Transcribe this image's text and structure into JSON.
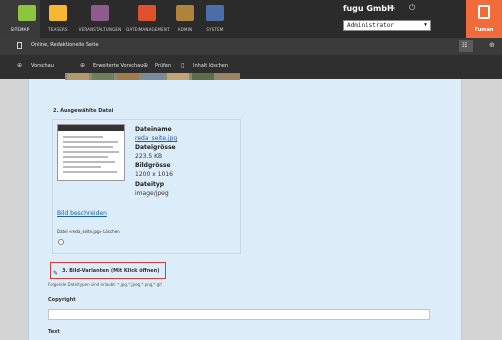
{
  "topnav": {
    "items": [
      {
        "label": "SITEMAP",
        "icon": "sitemap-icon",
        "color": "#8cc63f"
      },
      {
        "label": "TEASERS",
        "icon": "teaser-icon",
        "color": "#f7b731"
      },
      {
        "label": "VERANSTALTUNGEN",
        "icon": "events-icon",
        "color": "#8e5b8e"
      },
      {
        "label": "DATEIMANAGEMENT",
        "icon": "file-management-icon",
        "color": "#e0522e"
      },
      {
        "label": "ADMIN",
        "icon": "admin-folder-icon",
        "color": "#b0833b"
      },
      {
        "label": "SYSTEM",
        "icon": "system-gear-icon",
        "color": "#4a6ea8"
      }
    ],
    "company": "fugu GmbH",
    "role_value": "Administrator",
    "logo_text": "Fuman"
  },
  "pagebar": {
    "title": "Online, Redaktionelle Seite"
  },
  "toolbar": {
    "preview": "Vorschau",
    "extended_preview": "Erweiterte Vorschau",
    "check": "Prüfen",
    "delete_content": "Inhalt löschen"
  },
  "section2": {
    "title": "2. Ausgewählte Datei",
    "filename_label": "Dateiname",
    "filename_value": "reda_seite.jpg",
    "filesize_label": "Dateigrösse",
    "filesize_value": "223.5 KB",
    "imagesize_label": "Bildgrösse",
    "imagesize_value": "1200 x 1016",
    "filetype_label": "Dateityp",
    "filetype_value": "image/jpeg",
    "describe_link": "Bild beschreiden",
    "delete_text": "Datei «reda_seite.jpg» Löschen"
  },
  "section3": {
    "title": "3. Bild-Varianten (Mit Klick öffnen)",
    "filetypes_note": "Folgende Dateitypen sind erlaubt: *.jpg,*.jpeg,*.png,*.gif"
  },
  "fields": {
    "copyright_label": "Copyright",
    "text_label": "Text"
  },
  "colors": {
    "panel_bg": "#dcedf9",
    "highlight_border": "#d93a3a",
    "link": "#1b5fa8",
    "brand": "#f26b3a"
  }
}
